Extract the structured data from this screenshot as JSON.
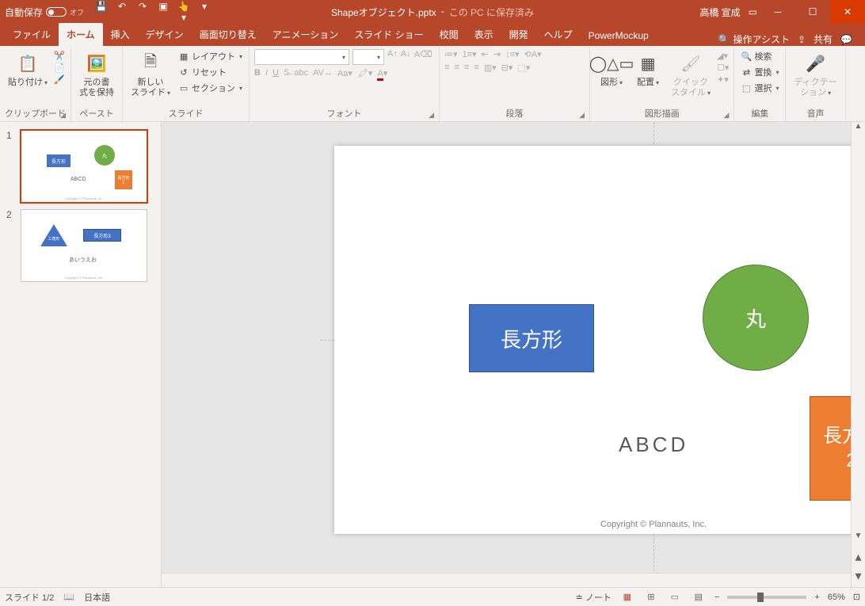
{
  "titlebar": {
    "autosave": "自動保存",
    "autosave_state": "オフ",
    "filename": "Shapeオブジェクト.pptx",
    "saved_location": "この PC に保存済み",
    "username": "高橋 宣成"
  },
  "tabs": {
    "file": "ファイル",
    "home": "ホーム",
    "insert": "挿入",
    "design": "デザイン",
    "transitions": "画面切り替え",
    "animations": "アニメーション",
    "slideshow": "スライド ショー",
    "review": "校閲",
    "view": "表示",
    "developer": "開発",
    "help": "ヘルプ",
    "powermockup": "PowerMockup",
    "tellme": "操作アシスト",
    "share": "共有"
  },
  "ribbon": {
    "clipboard": {
      "paste": "貼り付け",
      "label": "クリップボード"
    },
    "paste_keep": {
      "btn": "元の書\n式を保持",
      "label": "ペースト"
    },
    "slides": {
      "new": "新しい\nスライド",
      "layout": "レイアウト",
      "reset": "リセット",
      "section": "セクション",
      "label": "スライド"
    },
    "font": {
      "label": "フォント"
    },
    "paragraph": {
      "label": "段落"
    },
    "drawing": {
      "shapes": "図形",
      "arrange": "配置",
      "quick": "クイック\nスタイル",
      "label": "図形描画"
    },
    "editing": {
      "find": "検索",
      "replace": "置換",
      "select": "選択",
      "label": "編集"
    },
    "voice": {
      "dictate": "ディクテー\nション",
      "label": "音声"
    }
  },
  "slides": {
    "s1": {
      "rect1": "長方形",
      "circle": "丸",
      "rect2": "長方形\n2",
      "text": "ABCD",
      "copyright": "Copyright © Plannauts, Inc.",
      "page": "1"
    },
    "s2": {
      "tri": "三角\n形",
      "rect3": "長方形3",
      "text": "あいうえお"
    }
  },
  "status": {
    "slide": "スライド 1/2",
    "lang": "日本語",
    "notes": "ノート",
    "zoom": "65%"
  }
}
